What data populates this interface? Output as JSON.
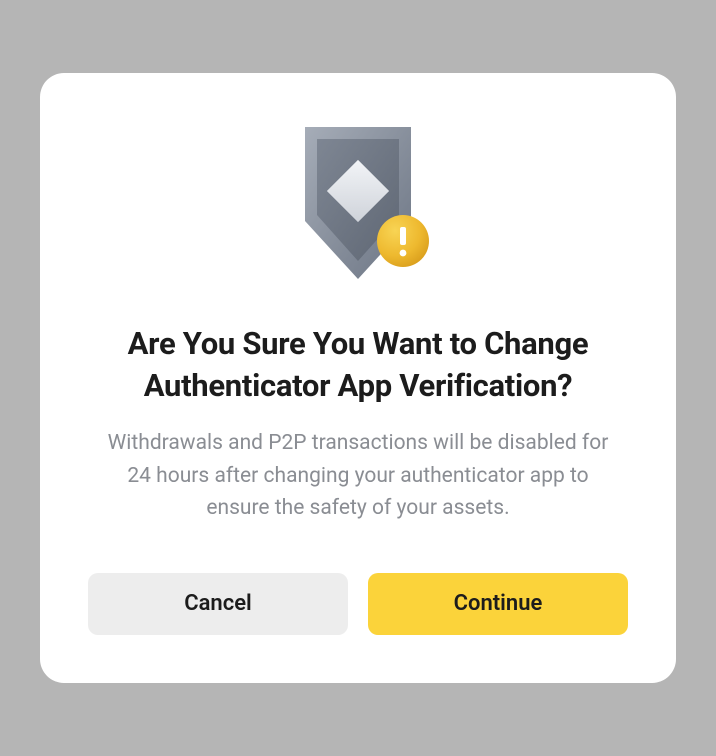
{
  "dialog": {
    "title": "Are You Sure You Want to Change Authenticator App Verification?",
    "description": "Withdrawals and P2P transactions will be disabled for 24 hours after changing your authenticator app to ensure the safety of your assets.",
    "cancel_label": "Cancel",
    "continue_label": "Continue"
  },
  "colors": {
    "accent": "#fbd33a",
    "muted_button": "#ededed",
    "text_primary": "#1c1c1c",
    "text_secondary": "#8a8d93"
  }
}
